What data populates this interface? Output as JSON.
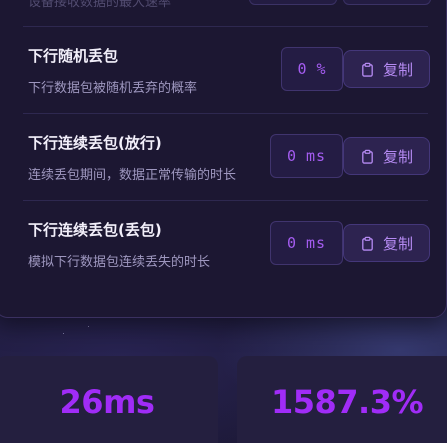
{
  "top_partial": {
    "description": "设备接收数据的最大速率"
  },
  "rows": [
    {
      "title": "下行随机丢包",
      "description": "下行数据包被随机丢弃的概率",
      "value": "0",
      "unit": "%",
      "copy_label": "复制"
    },
    {
      "title": "下行连续丢包(放行)",
      "description": "连续丢包期间，数据正常传输的时长",
      "value": "0",
      "unit": "ms",
      "copy_label": "复制"
    },
    {
      "title": "下行连续丢包(丢包)",
      "description": "模拟下行数据包连续丢失的时长",
      "value": "0",
      "unit": "ms",
      "copy_label": "复制"
    }
  ],
  "stats": [
    {
      "value": "26ms"
    },
    {
      "value": "1587.3%"
    }
  ],
  "colors": {
    "accent": "#a02cf7",
    "value_text": "#a45cf0",
    "copy_text": "#b58af2",
    "panel_bg": "#1c1732"
  },
  "icons": {
    "copy": "clipboard-icon"
  }
}
